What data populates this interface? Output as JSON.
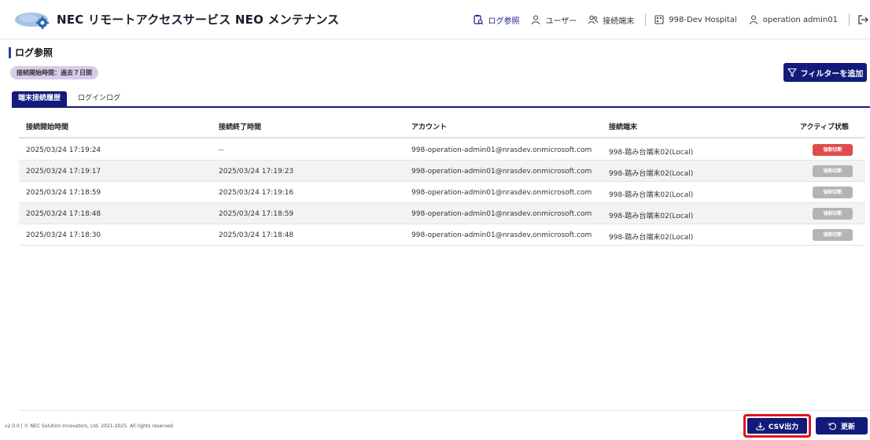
{
  "header": {
    "app_title": "NEC リモートアクセスサービス NEO メンテナンス",
    "nav": [
      {
        "label": "ログ参照",
        "icon": "log-search-icon"
      },
      {
        "label": "ユーザー",
        "icon": "user-icon"
      },
      {
        "label": "接続端末",
        "icon": "users-icon"
      },
      {
        "label": "998-Dev Hospital",
        "icon": "building-icon"
      },
      {
        "label": "operation admin01",
        "icon": "user-icon"
      }
    ]
  },
  "page": {
    "title": "ログ参照",
    "filter_chip": "接続開始時間：過去７日間",
    "filter_button": "フィルターを追加"
  },
  "tabs": [
    {
      "label": "端末接続履歴",
      "active": true
    },
    {
      "label": "ログインログ",
      "active": false
    }
  ],
  "table": {
    "columns": [
      "接続開始時間",
      "接続終了時間",
      "アカウント",
      "接続端末",
      "アクティブ状態"
    ],
    "rows": [
      {
        "start": "2025/03/24 17:19:24",
        "end": "--",
        "account": "998-operation-admin01@nrasdev.onmicrosoft.com",
        "device": "998-踏み台端末02(Local)",
        "status": "強制切断",
        "active": true
      },
      {
        "start": "2025/03/24 17:19:17",
        "end": "2025/03/24 17:19:23",
        "account": "998-operation-admin01@nrasdev.onmicrosoft.com",
        "device": "998-踏み台端末02(Local)",
        "status": "強制切断",
        "active": false
      },
      {
        "start": "2025/03/24 17:18:59",
        "end": "2025/03/24 17:19:16",
        "account": "998-operation-admin01@nrasdev.onmicrosoft.com",
        "device": "998-踏み台端末02(Local)",
        "status": "強制切断",
        "active": false
      },
      {
        "start": "2025/03/24 17:18:48",
        "end": "2025/03/24 17:18:59",
        "account": "998-operation-admin01@nrasdev.onmicrosoft.com",
        "device": "998-踏み台端末02(Local)",
        "status": "強制切断",
        "active": false
      },
      {
        "start": "2025/03/24 17:18:30",
        "end": "2025/03/24 17:18:48",
        "account": "998-operation-admin01@nrasdev.onmicrosoft.com",
        "device": "998-踏み台端末02(Local)",
        "status": "強制切断",
        "active": false
      }
    ]
  },
  "footer": {
    "text": "v2.0.0 | © NEC Solution Innovators, Ltd. 2021-2025. All rights reserved.",
    "csv_button": "CSV出力",
    "refresh_button": "更新"
  },
  "colors": {
    "primary": "#121b7a",
    "danger": "#e24b4b",
    "disabled": "#b4b4b4",
    "chip": "#d8ccec",
    "highlight": "#e0141e"
  }
}
